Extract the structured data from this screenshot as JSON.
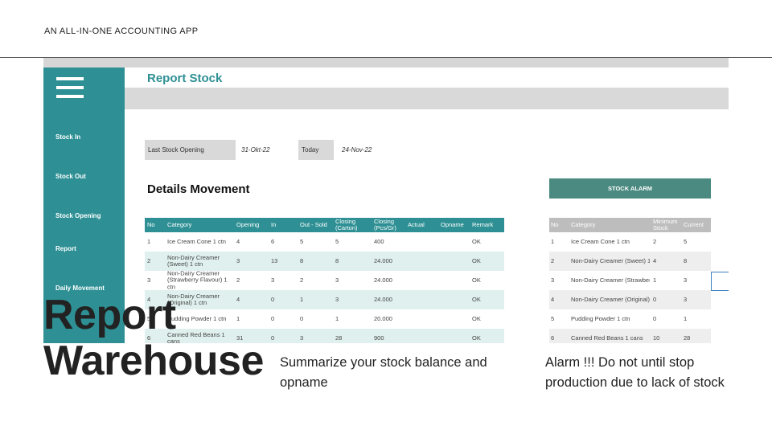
{
  "tagline": "AN ALL-IN-ONE ACCOUNTING APP",
  "app": {
    "title": "Report Stock",
    "sidebar_items": [
      "Stock In",
      "Stock Out",
      "Stock Opening",
      "Report",
      "Daily Movement"
    ],
    "fields": {
      "last_opening_label": "Last Stock Opening",
      "last_opening_value": "31-Okt-22",
      "today_label": "Today",
      "today_value": "24-Nov-22"
    },
    "details_title": "Details Movement",
    "details_columns": [
      "No",
      "Category",
      "Opening",
      "In",
      "Out - Sold",
      "Closing (Carton)",
      "Closing (Pcs/Gr)",
      "Actual",
      "Opname",
      "Remark"
    ],
    "details_rows": [
      {
        "no": "1",
        "category": "Ice Cream Cone 1 ctn",
        "opening": "4",
        "in": "6",
        "out": "5",
        "closing_carton": "5",
        "closing_pcs": "400",
        "actual": "",
        "opname": "",
        "remark": "OK"
      },
      {
        "no": "2",
        "category": "Non-Dairy Creamer (Sweet) 1 ctn",
        "opening": "3",
        "in": "13",
        "out": "8",
        "closing_carton": "8",
        "closing_pcs": "24.000",
        "actual": "",
        "opname": "",
        "remark": "OK"
      },
      {
        "no": "3",
        "category": "Non-Dairy Creamer (Strawberry Flavour) 1 ctn",
        "opening": "2",
        "in": "3",
        "out": "2",
        "closing_carton": "3",
        "closing_pcs": "24.000",
        "actual": "",
        "opname": "",
        "remark": "OK"
      },
      {
        "no": "4",
        "category": "Non-Dairy Creamer (Original) 1 ctn",
        "opening": "4",
        "in": "0",
        "out": "1",
        "closing_carton": "3",
        "closing_pcs": "24.000",
        "actual": "",
        "opname": "",
        "remark": "OK"
      },
      {
        "no": "5",
        "category": "Pudding Powder 1 ctn",
        "opening": "1",
        "in": "0",
        "out": "0",
        "closing_carton": "1",
        "closing_pcs": "20.000",
        "actual": "",
        "opname": "",
        "remark": "OK"
      },
      {
        "no": "6",
        "category": "Canned Red Beans 1 cans",
        "opening": "31",
        "in": "0",
        "out": "3",
        "closing_carton": "28",
        "closing_pcs": "900",
        "actual": "",
        "opname": "",
        "remark": "OK"
      }
    ],
    "alarm_button": "STOCK ALARM",
    "alarm_columns": [
      "No",
      "Category",
      "Minimum Stock",
      "Current"
    ],
    "alarm_rows": [
      {
        "no": "1",
        "category": "Ice Cream Cone 1 ctn",
        "min": "2",
        "current": "5"
      },
      {
        "no": "2",
        "category": "Non-Dairy Creamer (Sweet) 1 ctn",
        "min": "4",
        "current": "8"
      },
      {
        "no": "3",
        "category": "Non-Dairy Creamer (Strawberry Flavour) 1 ctn",
        "min": "1",
        "current": "3"
      },
      {
        "no": "4",
        "category": "Non-Dairy Creamer (Original) 1 ctn",
        "min": "0",
        "current": "3"
      },
      {
        "no": "5",
        "category": "Pudding Powder 1 ctn",
        "min": "0",
        "current": "1"
      },
      {
        "no": "6",
        "category": "Canned Red Beans 1 cans",
        "min": "10",
        "current": "28"
      }
    ]
  },
  "slide": {
    "title_line1": "Report",
    "title_line2": "Warehouse",
    "caption_left": "Summarize your stock balance and opname",
    "caption_right": "Alarm !!! Do not until stop production due to lack of stock"
  },
  "colors": {
    "accent": "#2e9094",
    "alarm": "#4a8a80",
    "row_alt": "#dff0ee"
  }
}
